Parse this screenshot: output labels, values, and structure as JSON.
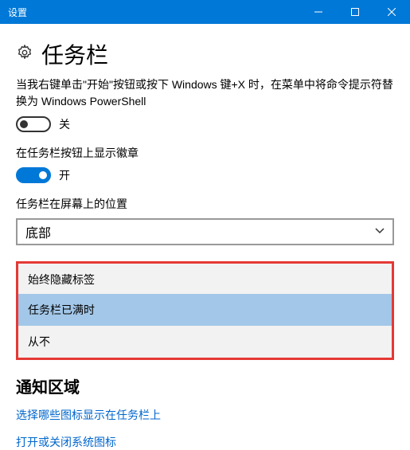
{
  "titlebar": {
    "title": "设置"
  },
  "header": {
    "title": "任务栏"
  },
  "desc1": "当我右键单击\"开始\"按钮或按下 Windows 键+X 时，在菜单中将命令提示符替换为 Windows PowerShell",
  "toggle1": {
    "state": "off",
    "label": "关"
  },
  "desc2": "在任务栏按钮上显示徽章",
  "toggle2": {
    "state": "on",
    "label": "开"
  },
  "position": {
    "label": "任务栏在屏幕上的位置",
    "value": "底部"
  },
  "combo": {
    "header": "始终隐藏标签",
    "options": [
      {
        "label": "任务栏已满时",
        "selected": true
      },
      {
        "label": "从不",
        "selected": false
      }
    ]
  },
  "notification": {
    "title": "通知区域",
    "link1": "选择哪些图标显示在任务栏上",
    "link2": "打开或关闭系统图标"
  }
}
